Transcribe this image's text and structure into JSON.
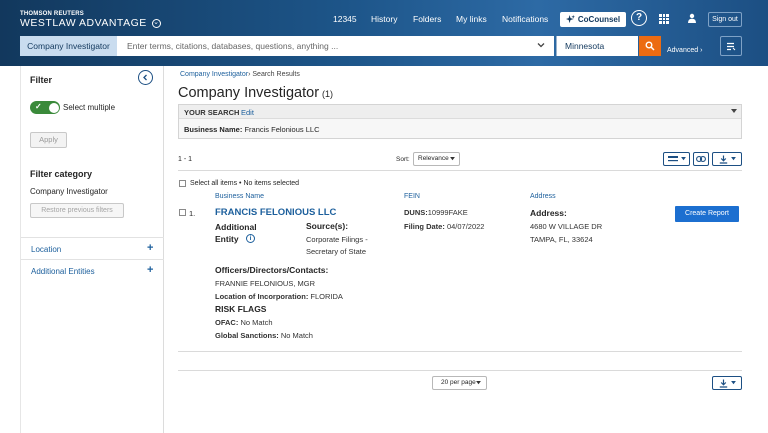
{
  "header": {
    "brand_small": "THOMSON REUTERS",
    "brand_big": "WESTLAW ADVANTAGE",
    "nav": [
      "12345",
      "History",
      "Folders",
      "My links",
      "Notifications"
    ],
    "cocounsel": "CoCounsel",
    "help": "?",
    "signout": "Sign out"
  },
  "search": {
    "scope": "Company Investigator",
    "placeholder": "Enter terms, citations, databases, questions, anything ...",
    "jurisdiction": "Minnesota",
    "advanced": "Advanced"
  },
  "filter": {
    "title": "Filter",
    "select_multiple": "Select multiple",
    "select_multiple_on": true,
    "apply": "Apply",
    "category_title": "Filter category",
    "category_value": "Company Investigator",
    "restore": "Restore previous filters",
    "sections": [
      "Location",
      "Additional Entities"
    ]
  },
  "main": {
    "breadcrumb_link": "Company Investigator",
    "breadcrumb_current": "Search Results",
    "title": "Company Investigator",
    "count": "(1)",
    "your_search": {
      "label": "YOUR SEARCH",
      "edit": "Edit",
      "business_name_label": "Business Name:",
      "business_name_value": "Francis Felonious LLC"
    },
    "range": "1 - 1",
    "sort_label": "Sort:",
    "sort_value": "Relevance",
    "select_all": "Select all items",
    "selected_status": "No items selected",
    "columns": [
      "Business Name",
      "FEIN",
      "Address"
    ],
    "result": {
      "num": "1.",
      "name": "FRANCIS FELONIOUS LLC",
      "additional_entity": "Additional Entity",
      "sources_label": "Source(s):",
      "sources_value": "Corporate Filings - Secretary of State",
      "duns_label": "DUNS:",
      "duns_value": "10999FAKE",
      "filing_label": "Filing Date:",
      "filing_value": "04/07/2022",
      "address_label": "Address:",
      "address_line1": "4680 W VILLAGE DR",
      "address_line2": "TAMPA, FL, 33624",
      "officers_label": "Officers/Directors/Contacts:",
      "officers_value": "FRANNIE FELONIOUS, MGR",
      "incorp_label": "Location of Incorporation:",
      "incorp_value": "FLORIDA",
      "risk_flags": "RISK FLAGS",
      "ofac_label": "OFAC:",
      "ofac_value": "No Match",
      "global_label": "Global Sanctions:",
      "global_value": "No Match",
      "create_report": "Create Report"
    },
    "per_page": "20 per page"
  },
  "icons": {
    "collapse": "chevron-left-icon",
    "cocounsel": "sparkle-icon",
    "go": "search-icon",
    "apps": "grid-icon",
    "user": "person-icon",
    "history": "list-icon",
    "view": "list-view-icon",
    "link": "link-icon",
    "download": "download-icon",
    "info": "info-icon"
  },
  "colors": {
    "header_dark": "#12385d",
    "header_light": "#2d6aa5",
    "link": "#1c5f9c",
    "go_button": "#ec6b12",
    "create_button": "#1c6fd0",
    "toggle_on": "#3a8a3a"
  }
}
